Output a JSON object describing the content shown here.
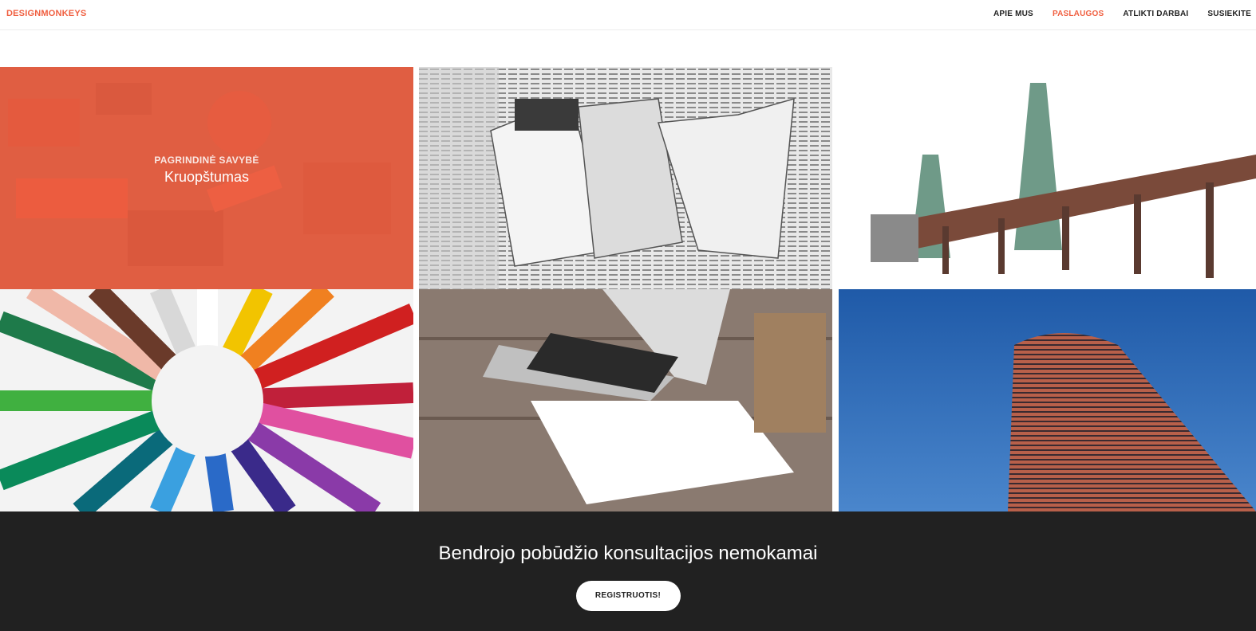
{
  "navbar": {
    "brand": "DESIGNMONKEYS",
    "links": [
      {
        "label": "APIE MUS",
        "active": false
      },
      {
        "label": "PASLAUGOS",
        "active": true
      },
      {
        "label": "ATLIKTI DARBAI",
        "active": false
      },
      {
        "label": "SUSIEKITE",
        "active": false
      }
    ],
    "accent_color": "#f05f40"
  },
  "portfolio": {
    "hovered_item": {
      "category": "PAGRINDINĖ SAVYBĖ",
      "name": "Kruopštumas"
    },
    "overlay_color": "#f05f40"
  },
  "cta": {
    "heading": "Bendrojo pobūdžio konsultacijos nemokamai",
    "button_label": "REGISTRUOTIS!",
    "background": "#212121"
  }
}
